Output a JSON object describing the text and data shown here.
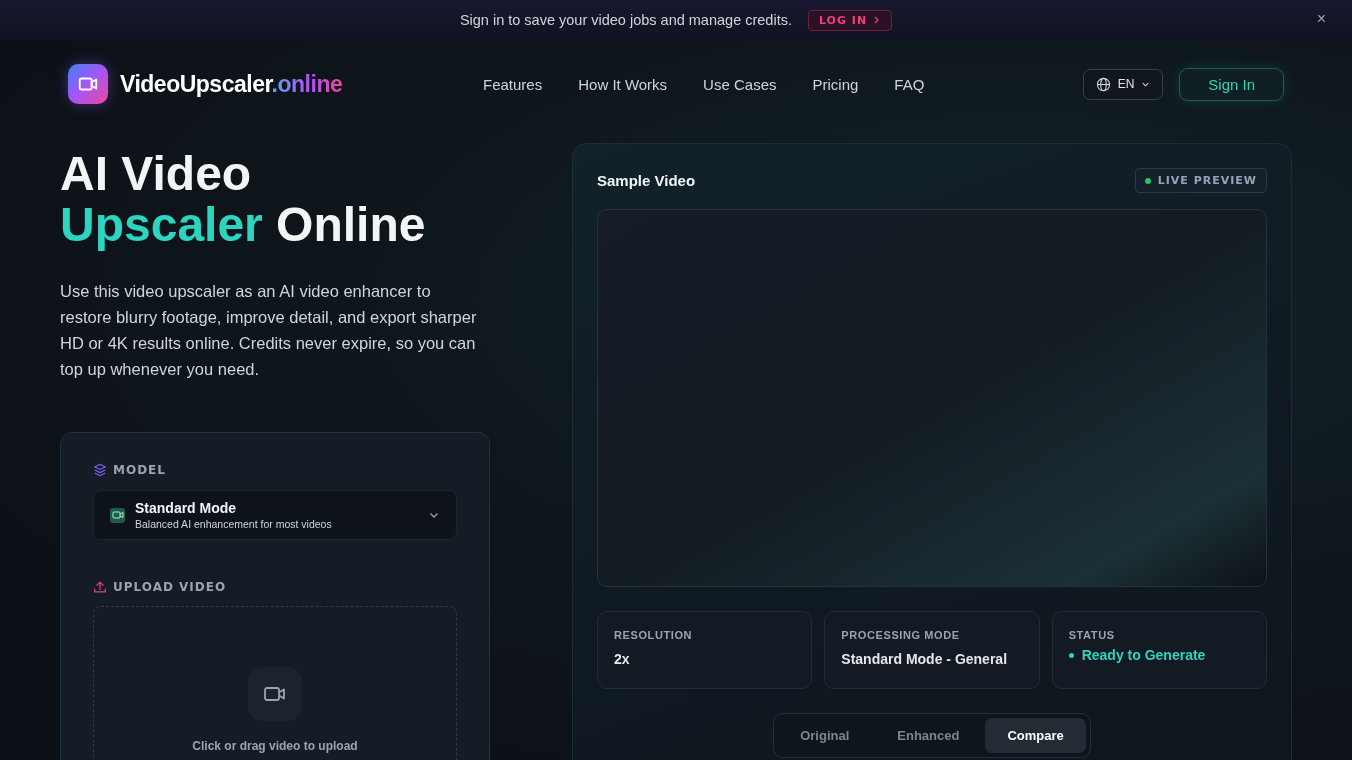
{
  "banner": {
    "text": "Sign in to save your video jobs and manage credits.",
    "button": "LOG IN",
    "close": "×"
  },
  "header": {
    "brand": [
      {
        "text": "VideoUpscaler",
        "accent": false
      },
      {
        "text": ".online",
        "accent": true
      }
    ],
    "nav": [
      "Features",
      "How It Works",
      "Use Cases",
      "Pricing",
      "FAQ"
    ],
    "language": "EN",
    "sign_in": "Sign In"
  },
  "hero": {
    "title_lines": [
      [
        {
          "text": "AI Video",
          "accent": false
        }
      ],
      [
        {
          "text": "Upscaler",
          "accent": true
        },
        {
          "text": " Online",
          "accent": false
        }
      ]
    ],
    "description": "Use this video upscaler as an AI video enhancer to restore blurry footage, improve detail, and export sharper HD or 4K results online. Credits never expire, so you can top up whenever you need."
  },
  "form": {
    "model_label": "MODEL",
    "model": {
      "name": "Standard Mode",
      "description": "Balanced AI enhancement for most videos"
    },
    "upload_label": "UPLOAD VIDEO",
    "upload_hint": "Click or drag video to upload"
  },
  "preview": {
    "title": "Sample Video",
    "badge": "LIVE PREVIEW",
    "stats": [
      {
        "label": "RESOLUTION",
        "value": "2x",
        "kind": "plain"
      },
      {
        "label": "PROCESSING MODE",
        "value": "Standard Mode - General",
        "kind": "plain"
      },
      {
        "label": "STATUS",
        "value": "Ready to Generate",
        "kind": "status"
      }
    ],
    "tabs": [
      {
        "label": "Original",
        "selected": false
      },
      {
        "label": "Enhanced",
        "selected": false
      },
      {
        "label": "Compare",
        "selected": true
      }
    ]
  }
}
